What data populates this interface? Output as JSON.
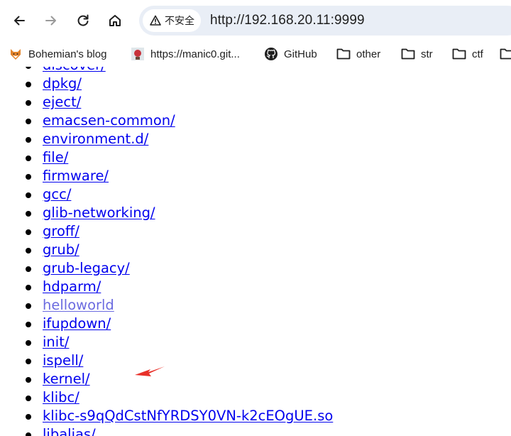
{
  "toolbar": {
    "back_icon": "arrow-left-icon",
    "forward_icon": "arrow-right-icon",
    "reload_icon": "reload-icon",
    "home_icon": "home-icon",
    "security_label": "不安全",
    "url": "http://192.168.20.11:9999"
  },
  "bookmarks": [
    {
      "label": "Bohemian's blog",
      "icon": "fox-favicon"
    },
    {
      "label": "https://manic0.git...",
      "icon": "site-favicon"
    },
    {
      "label": "GitHub",
      "icon": "github-icon"
    },
    {
      "label": "other",
      "icon": "folder-icon"
    },
    {
      "label": "str",
      "icon": "folder-icon"
    },
    {
      "label": "ctf",
      "icon": "folder-icon"
    }
  ],
  "listing": [
    "discover/",
    "dpkg/",
    "eject/",
    "emacsen-common/",
    "environment.d/",
    "file/",
    "firmware/",
    "gcc/",
    "glib-networking/",
    "groff/",
    "grub/",
    "grub-legacy/",
    "hdparm/",
    "helloworld",
    "ifupdown/",
    "init/",
    "ispell/",
    "kernel/",
    "klibc/",
    "klibc-s9qQdCstNfYRDSY0VN-k2cEOgUE.so",
    "libalias/"
  ],
  "colors": {
    "link": "#0000ee",
    "highlight_link": "#6b6be0",
    "arrow": "#e8312a",
    "omnibox_bg": "#e9eef6"
  }
}
